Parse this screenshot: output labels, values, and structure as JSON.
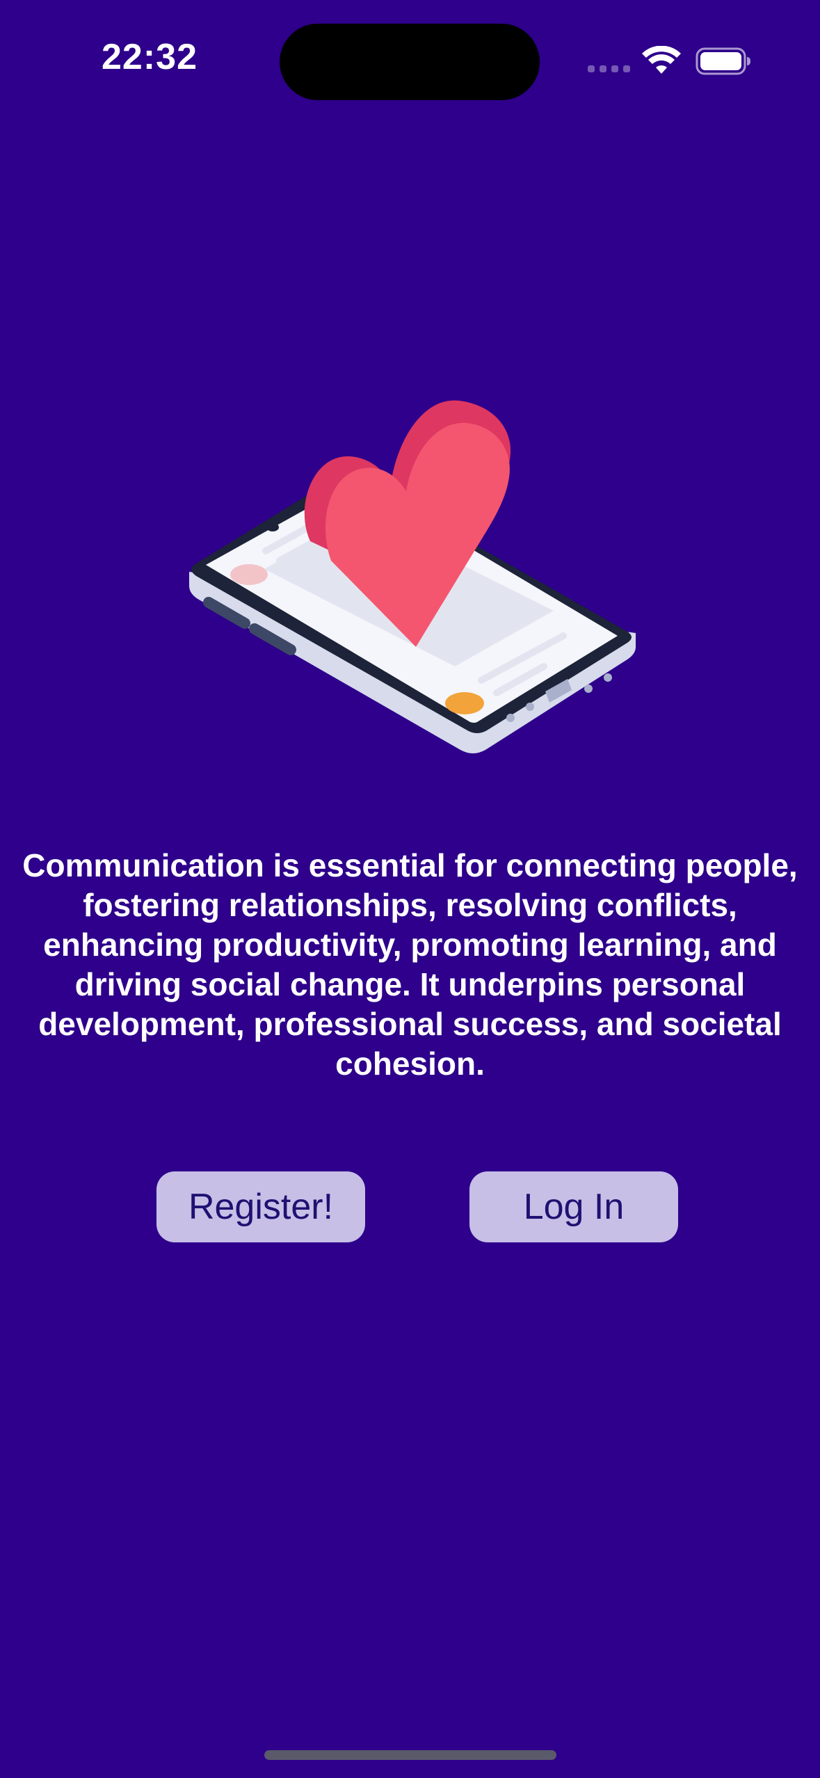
{
  "status_bar": {
    "time": "22:32",
    "icons": [
      "cellular-signal-icon",
      "wifi-icon",
      "battery-icon"
    ]
  },
  "hero": {
    "icon": "phone-with-heart-illustration"
  },
  "main": {
    "description": "Communication is essential for connecting people, fostering relationships, resolving conflicts, enhancing productivity, promoting learning, and driving social change. It underpins personal development, professional success, and societal cohesion."
  },
  "buttons": {
    "register_label": "Register!",
    "login_label": "Log In"
  },
  "colors": {
    "background": "#2e008b",
    "button_bg": "#c7bfe6",
    "button_text": "#1f1172",
    "heart": "#f4566f",
    "heart_side": "#de3761",
    "accent_orange": "#f2a33a"
  }
}
